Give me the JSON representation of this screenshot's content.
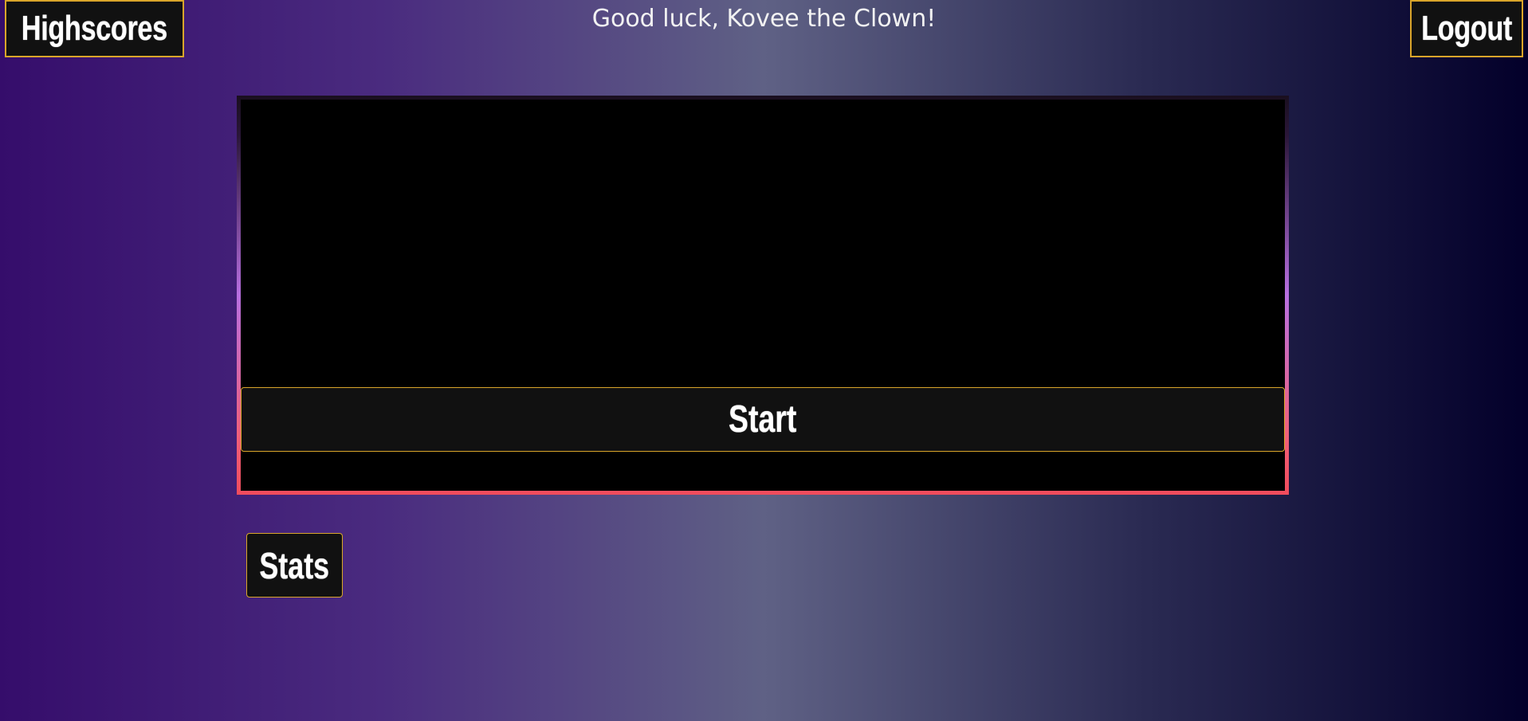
{
  "header": {
    "highscores_label": "Highscores",
    "greeting": "Good luck, Kovee the Clown!",
    "logout_label": "Logout"
  },
  "game": {
    "start_label": "Start"
  },
  "footer": {
    "stats_label": "Stats"
  },
  "colors": {
    "button_border": "#d9a52a",
    "button_bg": "#111111",
    "canvas_bg": "#000000",
    "frame_gradient_top": "#1a0f1f",
    "frame_gradient_mid": "#b86fe0",
    "frame_gradient_bottom": "#f04c5c"
  }
}
